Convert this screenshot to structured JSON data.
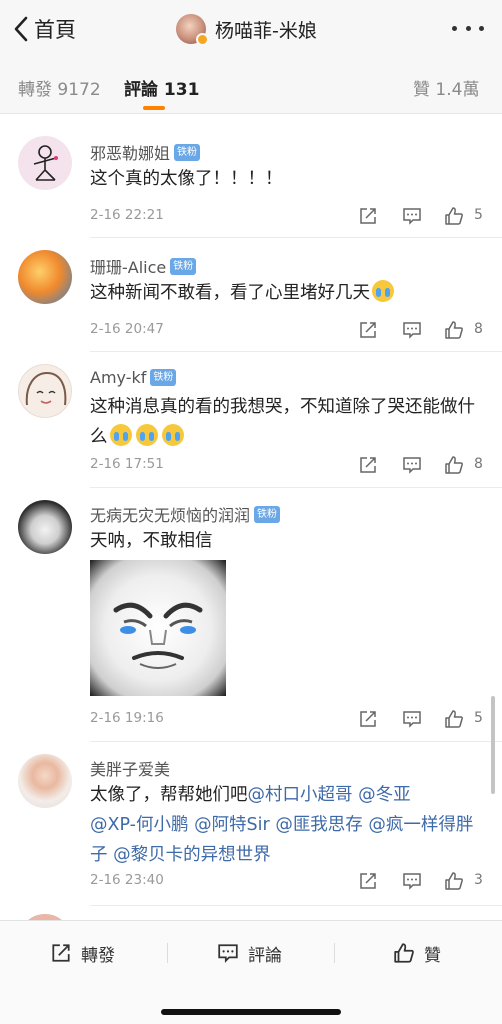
{
  "nav": {
    "back_label": "首頁",
    "title": "杨喵菲-米娘"
  },
  "tabs": {
    "repost": "轉發 9172",
    "comments": "評論 131",
    "likes": "贊 1.4萬"
  },
  "badge_text": "铁粉",
  "comments": [
    {
      "name": "邪恶勒娜姐",
      "text": "这个真的太像了！！！！",
      "time": "2-16 22:21",
      "likes": "5"
    },
    {
      "name": "珊珊-Alice",
      "text": "这种新闻不敢看，看了心里堵好几天",
      "time": "2-16 20:47",
      "likes": "8"
    },
    {
      "name": "Amy-kf",
      "text": "这种消息真的看的我想哭，不知道除了哭还能做什么",
      "time": "2-16 17:51",
      "likes": "8"
    },
    {
      "name": "无病无灾无烦恼的润润",
      "text": "天呐，不敢相信",
      "time": "2-16 19:16",
      "likes": "5"
    },
    {
      "name": "美胖子爱美",
      "text_prefix": "太像了，帮帮她们吧",
      "mentions": [
        "@村口小超哥",
        "@冬亚",
        "@XP-何小鹏",
        "@阿特Sir",
        "@匪我思存",
        "@疯一样得胖子",
        "@黎贝卡的异想世界"
      ],
      "time": "2-16 23:40",
      "likes": "3"
    }
  ],
  "bottom": {
    "repost": "轉發",
    "comment": "評論",
    "like": "贊"
  },
  "icons": {
    "back": "chevron-left-icon",
    "more": "more-dots-icon",
    "repost": "share-icon",
    "comment": "comment-icon",
    "like": "thumbs-up-icon",
    "emoji": "crying-face-emoji"
  },
  "colors": {
    "accent": "#ff8200",
    "badge": "#6aa7e6",
    "mention": "#3f6aa8"
  }
}
